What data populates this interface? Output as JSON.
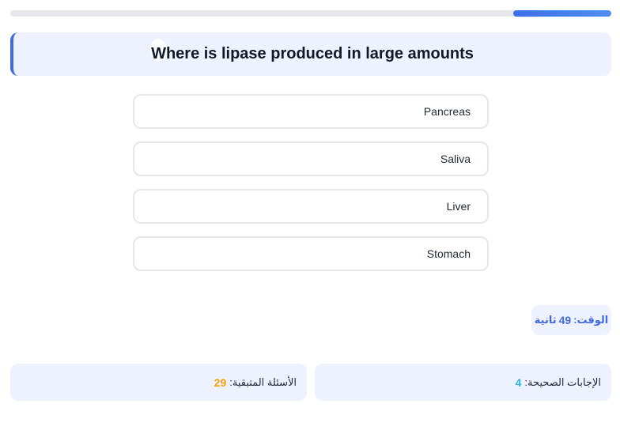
{
  "progress": {
    "value_percent": 16.3,
    "accent_color": "#4169e1"
  },
  "question": {
    "text": "Where is lipase produced in large amounts"
  },
  "options": [
    {
      "label": "Pancreas"
    },
    {
      "label": "Saliva"
    },
    {
      "label": "Liver"
    },
    {
      "label": "Stomach"
    }
  ],
  "timer": {
    "label": "الوقت:",
    "value": "49",
    "unit": "ثانية"
  },
  "stats": {
    "correct": {
      "label": "الإجابات الصحيحة:",
      "value": "4",
      "color": "#2bb5e0"
    },
    "remaining": {
      "label": "الأسئلة المتبقية:",
      "value": "29",
      "color": "#f59e0b"
    }
  }
}
